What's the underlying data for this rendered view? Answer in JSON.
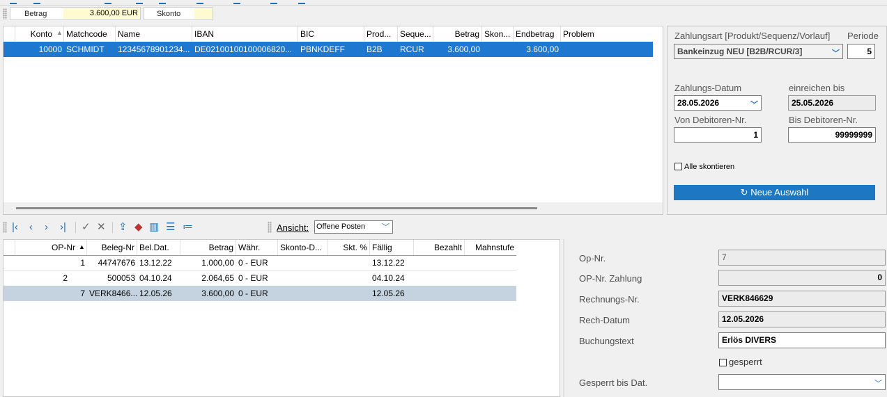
{
  "summary": {
    "betrag_label": "Betrag",
    "betrag_value": "3.600,00 EUR",
    "skonto_label": "Skonto"
  },
  "top_table": {
    "headers": [
      "Konto",
      "Matchcode",
      "Name",
      "IBAN",
      "BIC",
      "Prod...",
      "Seque...",
      "Betrag",
      "Skon...",
      "Endbetrag",
      "Problem"
    ],
    "rows": [
      {
        "konto": "10000",
        "matchcode": "SCHMIDT",
        "name": "12345678901234...",
        "iban": "DE02100100100006820...",
        "bic": "PBNKDEFF",
        "prod": "B2B",
        "seq": "RCUR",
        "betrag": "3.600,00",
        "skonto": "",
        "endbetrag": "3.600,00",
        "problem": ""
      }
    ]
  },
  "settings": {
    "zahlungsart_label": "Zahlungsart [Produkt/Sequenz/Vorlauf]",
    "zahlungsart_value": "Bankeinzug NEU [B2B/RCUR/3]",
    "periode_label": "Periode",
    "periode_value": "5",
    "zahlungs_datum_label": "Zahlungs-Datum",
    "zahlungs_datum_value": "28.05.2026",
    "einreichen_label": "einreichen bis",
    "einreichen_value": "25.05.2026",
    "von_label": "Von Debitoren-Nr.",
    "von_value": "1",
    "bis_label": "Bis Debitoren-Nr.",
    "bis_value": "99999999",
    "alle_skontieren_label": "Alle skontieren",
    "neue_auswahl_label": "Neue Auswahl"
  },
  "toolbar": {
    "ansicht_label": "Ansicht:",
    "ansicht_value": "Offene Posten"
  },
  "op_table": {
    "headers": [
      "OP-Nr",
      "Beleg-Nr",
      "Bel.Dat.",
      "Betrag",
      "Währ.",
      "Skonto-D...",
      "Skt. %",
      "Fällig",
      "Bezahlt",
      "Mahnstufe"
    ],
    "rows": [
      {
        "op": "1",
        "beleg": "44747676",
        "dat": "13.12.22",
        "betrag": "1.000,00",
        "waehr": "0 - EUR",
        "skd": "",
        "skt": "",
        "faellig": "13.12.22",
        "bezahlt": "",
        "mahn": ""
      },
      {
        "op": "2",
        "beleg": "500053",
        "dat": "04.10.24",
        "betrag": "2.064,65",
        "waehr": "0 - EUR",
        "skd": "",
        "skt": "",
        "faellig": "04.10.24",
        "bezahlt": "",
        "mahn": ""
      },
      {
        "op": "7",
        "beleg": "VERK8466...",
        "dat": "12.05.26",
        "betrag": "3.600,00",
        "waehr": "0 - EUR",
        "skd": "",
        "skt": "",
        "faellig": "12.05.26",
        "bezahlt": "",
        "mahn": ""
      }
    ]
  },
  "detail": {
    "op_nr_label": "Op-Nr.",
    "op_nr_value": "7",
    "op_nr_zahlung_label": "OP-Nr. Zahlung",
    "op_nr_zahlung_value": "0",
    "rechnungs_nr_label": "Rechnungs-Nr.",
    "rechnungs_nr_value": "VERK846629",
    "rech_datum_label": "Rech-Datum",
    "rech_datum_value": "12.05.2026",
    "buchungstext_label": "Buchungstext",
    "buchungstext_value": "Erlös DIVERS",
    "gesperrt_label": "gesperrt",
    "gesperrt_bis_label": "Gesperrt bis Dat.",
    "gesperrt_bis_value": ""
  },
  "colors": {
    "selection": "#1e78d0",
    "accent": "#1d78c1",
    "highlight_row": "#c5d3e0"
  }
}
